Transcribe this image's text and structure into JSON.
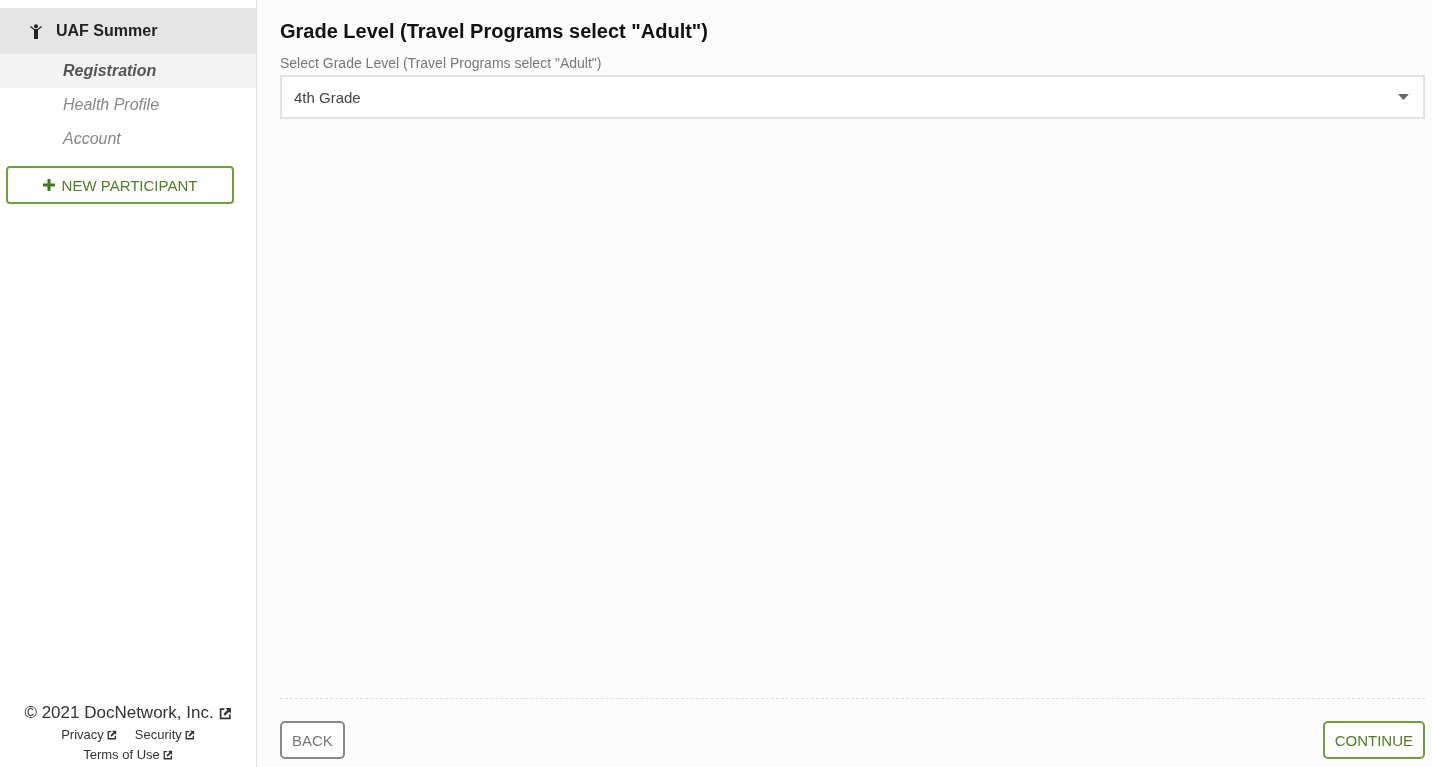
{
  "sidebar": {
    "program": "UAF Summer",
    "items": [
      {
        "label": "Registration",
        "selected": true
      },
      {
        "label": "Health Profile",
        "selected": false
      },
      {
        "label": "Account",
        "selected": false
      }
    ],
    "new_button": "NEW PARTICIPANT",
    "footer": {
      "copyright": "© 2021 DocNetwork, Inc.",
      "links": [
        "Privacy",
        "Security",
        "Terms of Use"
      ]
    }
  },
  "main": {
    "heading": "Grade Level (Travel Programs select \"Adult\")",
    "field": {
      "label": "Select Grade Level (Travel Programs select \"Adult\")",
      "value": "4th Grade"
    },
    "buttons": {
      "back": "BACK",
      "continue": "CONTINUE"
    }
  }
}
